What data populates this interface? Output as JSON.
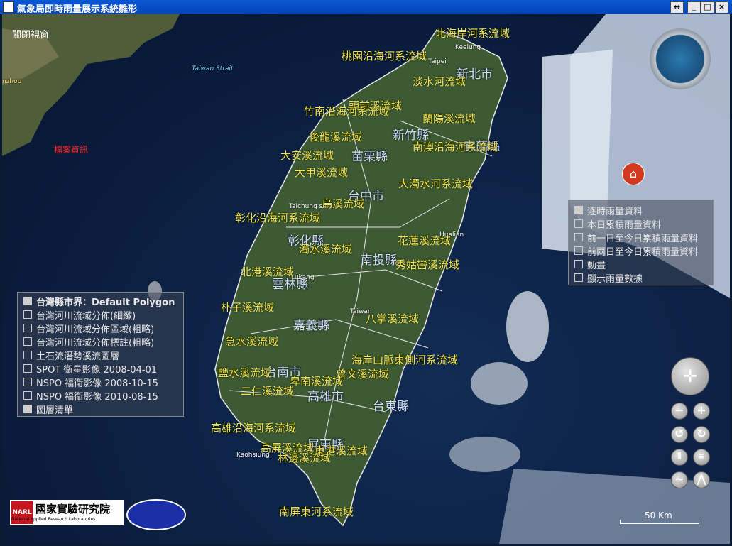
{
  "window": {
    "title": "氣象局即時雨量展示系統雛形"
  },
  "close_view_label": "關閉視窗",
  "file_info_label": "檔案資訊",
  "sea_labels": {
    "taiwan_strait": "Taiwan Strait",
    "zhou": "nzhou"
  },
  "city_labels": [
    "Keelung",
    "Taipei",
    "Taichung shih",
    "Hualian",
    "Lukang",
    "Taiwan",
    "Kaohsiung"
  ],
  "counties": [
    "新北市",
    "新竹縣",
    "宜蘭縣",
    "苗栗縣",
    "台中市",
    "彰化縣",
    "南投縣",
    "雲林縣",
    "嘉義縣",
    "台南市",
    "高雄市",
    "台東縣",
    "屏東縣"
  ],
  "basins": [
    "北海岸河系流域",
    "桃園沿海河系流域",
    "淡水河流域",
    "頭前溪流域",
    "竹南沿海河系流域",
    "蘭陽溪流域",
    "後龍溪流域",
    "南澳沿海河系流域",
    "大安溪流域",
    "大甲溪流域",
    "大濁水河系流域",
    "烏溪流域",
    "彰化沿海河系流域",
    "花蓮溪流域",
    "濁水溪流域",
    "北港溪流域",
    "秀姑巒溪流域",
    "朴子溪流域",
    "八掌溪流域",
    "急水溪流域",
    "海岸山脈東側河系流域",
    "鹽水溪流域",
    "曾文溪流域",
    "卑南溪流域",
    "二仁溪流域",
    "高屏溪流域",
    "高雄沿海河系流域",
    "東港溪流域",
    "林邊溪流域",
    "南屏東河系流域"
  ],
  "rain_panel": {
    "items": [
      {
        "label": "逐時雨量資料",
        "checked": true
      },
      {
        "label": "本日累積雨量資料",
        "checked": false
      },
      {
        "label": "前一日至今日累積雨量資料",
        "checked": false
      },
      {
        "label": "前兩日至今日累積雨量資料",
        "checked": false
      },
      {
        "label": "動畫",
        "checked": false
      },
      {
        "label": "顯示雨量數據",
        "checked": false
      }
    ]
  },
  "layer_panel": {
    "items": [
      {
        "label": "台灣縣市界：Default Polygon",
        "checked": true
      },
      {
        "label": "台灣河川流域分佈(細緻)",
        "checked": false
      },
      {
        "label": "台灣河川流域分佈區域(粗略)",
        "checked": false
      },
      {
        "label": "台灣河川流域分佈標註(粗略)",
        "checked": false
      },
      {
        "label": "土石流潛勢溪流圖層",
        "checked": false
      },
      {
        "label": "SPOT 衛星影像 2008-04-01",
        "checked": false
      },
      {
        "label": "NSPO 福衛影像 2008-10-15",
        "checked": false
      },
      {
        "label": "NSPO 福衛影像 2010-08-15",
        "checked": false
      },
      {
        "label": "圖層清單",
        "checked": true
      }
    ]
  },
  "scale_label": "50 Km",
  "logo": {
    "org": "國家實驗研究院",
    "org_en": "National Applied Research Laboratories",
    "mark": "NARL"
  },
  "icons": [
    "compass-icon",
    "home-icon",
    "pan-icon",
    "zoom-in-icon",
    "zoom-out-icon",
    "rotate-left-icon",
    "rotate-right-icon",
    "tilt-up-icon",
    "tilt-down-icon",
    "exaggeration-icon",
    "terrain-icon"
  ]
}
